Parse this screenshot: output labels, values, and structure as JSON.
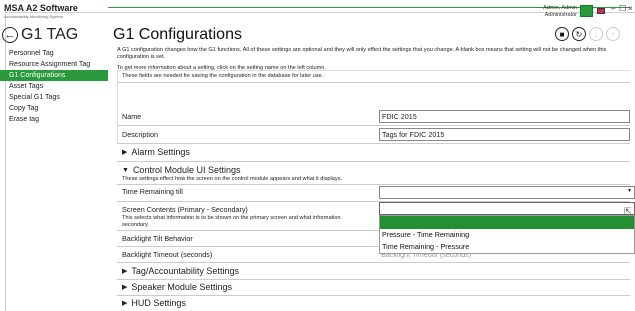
{
  "app": {
    "name": "MSA A2 Software",
    "subtitle": "Accountability Monitoring System"
  },
  "header": {
    "user_name": "Admin, Admin",
    "user_role": "Administrator",
    "minimize": "–",
    "maximize": "☐",
    "close": "×"
  },
  "sidebar": {
    "title": "G1 TAG",
    "items": [
      {
        "label": "Personnel Tag",
        "active": false
      },
      {
        "label": "Resource Assignment Tag",
        "active": false
      },
      {
        "label": "G1 Configurations",
        "active": true
      },
      {
        "label": "Asset Tags",
        "active": false
      },
      {
        "label": "Special G1 Tags",
        "active": false
      },
      {
        "label": "Copy Tag",
        "active": false
      },
      {
        "label": "Erase tag",
        "active": false
      }
    ]
  },
  "main": {
    "title": "G1 Configurations",
    "intro": "A G1 configuration changes how the G1 functions. All of these settings are optional and they will only effect the settings that you change. A blank box means that setting will not be changed when this configuration is set.",
    "info": "To get more information about a setting, click on the setting name on the left column.",
    "db_note": "These fields are needed for saving the configuration in the database for later use.",
    "name_label": "Name",
    "name_value": "FDIC 2015",
    "description_label": "Description",
    "description_value": "Tags for FDIC 2015",
    "sections": {
      "alarm": "Alarm Settings",
      "control_module": "Control Module UI Settings",
      "tag_accountability": "Tag/Accountability Settings",
      "speaker": "Speaker Module Settings",
      "hud": "HUD Settings"
    },
    "control_module": {
      "note": "These settings effect how the screen on the control module appears and what it displays.",
      "time_remaining_label": "Time Remaining till",
      "screen_contents_label": "Screen Contents (Primary - Secondary)",
      "screen_contents_note": "This selects what information is to be shown on the primary screen and what information",
      "screen_contents_note2": "secondary.",
      "backlight_tilt_label": "Backlight Tilt Behavior",
      "backlight_timeout_label": "Backlight Timeout (seconds)"
    },
    "dropdown_options": [
      "",
      "Pressure - Time Remaining",
      "Time Remaining - Pressure"
    ],
    "hidden_text": "Backlight Timeout (seconds)"
  },
  "colors": {
    "accent": "#2a9a3c"
  }
}
